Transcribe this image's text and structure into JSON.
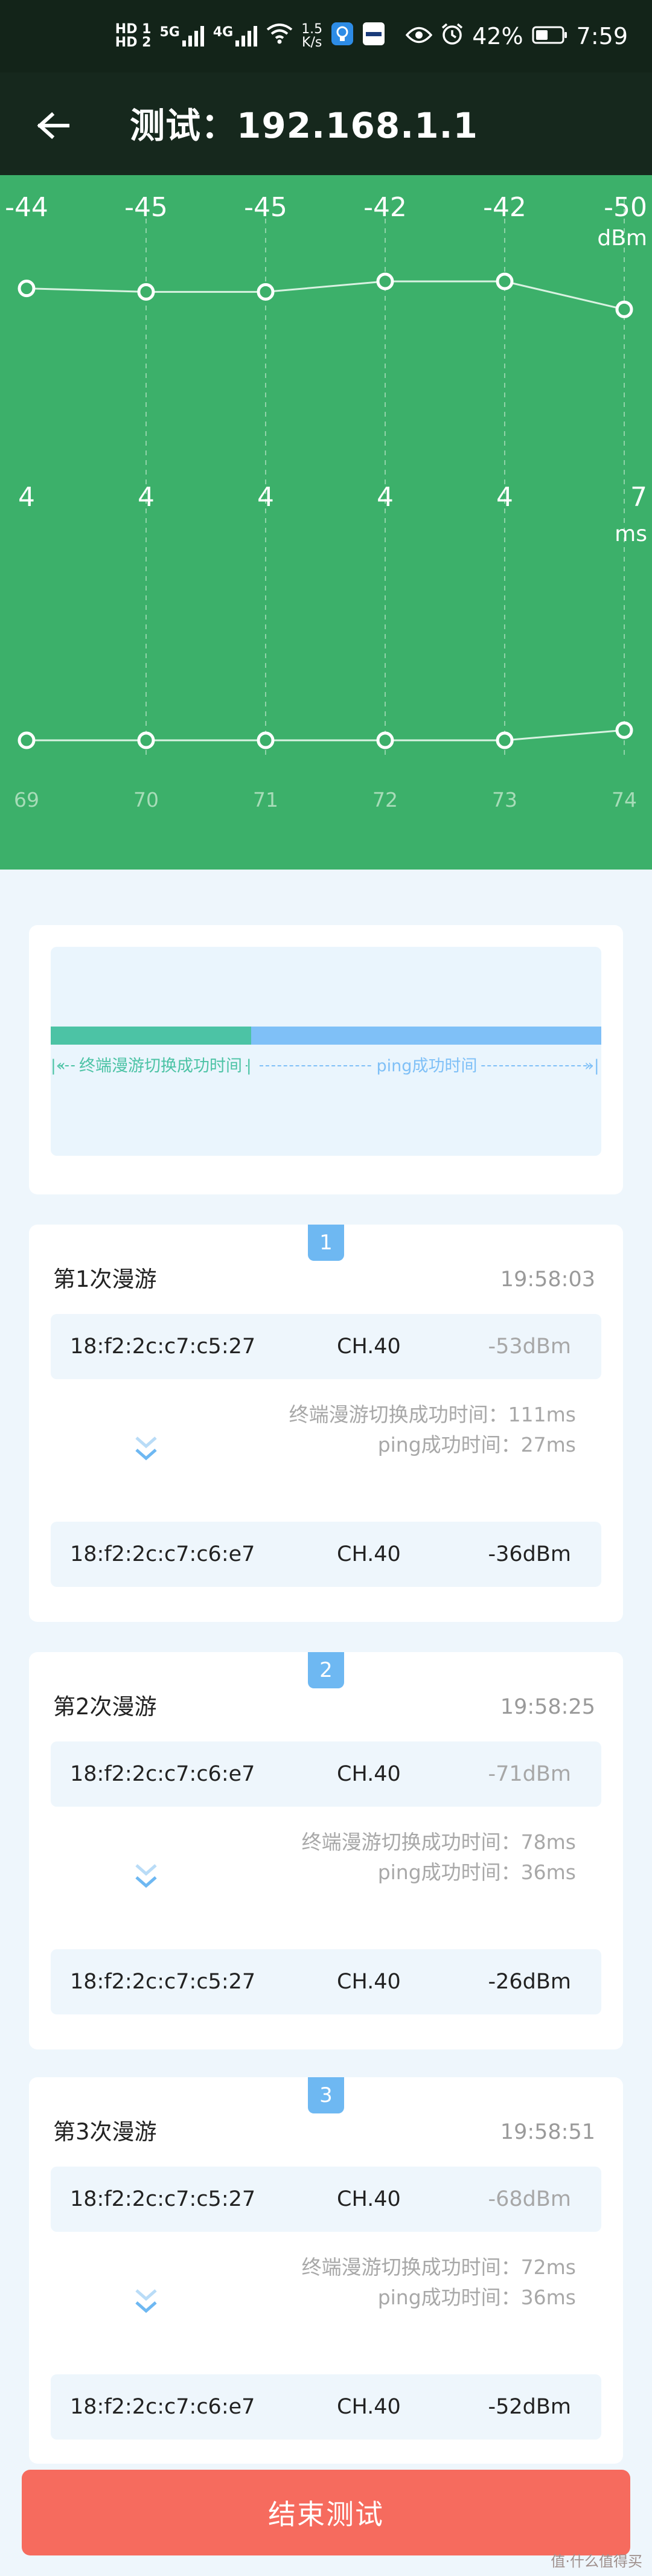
{
  "status_bar": {
    "net1": "HD 1",
    "net2": "HD 2",
    "sig1": "5G",
    "sig2": "4G",
    "speed_value": "1.5",
    "speed_unit": "K/s",
    "battery": "42%",
    "time": "7:59"
  },
  "app_bar": {
    "back_icon": "arrow-left-icon",
    "title": "测试：192.168.1.1"
  },
  "chart_data": [
    {
      "type": "line",
      "x": [
        69,
        70,
        71,
        72,
        73,
        74
      ],
      "values": [
        -44,
        -45,
        -45,
        -42,
        -42,
        -50
      ],
      "value_labels": [
        "-44",
        "-45",
        "-45",
        "-42",
        "-42",
        "-50"
      ],
      "unit": "dBm"
    },
    {
      "type": "line",
      "x": [
        69,
        70,
        71,
        72,
        73,
        74
      ],
      "x_labels": [
        "69",
        "70",
        "71",
        "72",
        "73",
        "74"
      ],
      "values": [
        4,
        4,
        4,
        4,
        4,
        7
      ],
      "value_labels": [
        "4",
        "4",
        "4",
        "4",
        "4",
        "7"
      ],
      "unit": "ms"
    }
  ],
  "legend": {
    "handover_label": "终端漫游切换成功时间",
    "ping_label": "ping成功时间",
    "handover_color": "#4cc3a5",
    "ping_color": "#7fc0f7"
  },
  "roams": [
    {
      "index": "1",
      "title": "第1次漫游",
      "time": "19:58:03",
      "from": {
        "mac": "18:f2:2c:c7:c5:27",
        "channel": "CH.40",
        "signal": "-53dBm"
      },
      "handover_text": "终端漫游切换成功时间：111ms",
      "ping_text": "ping成功时间：27ms",
      "to": {
        "mac": "18:f2:2c:c7:c6:e7",
        "channel": "CH.40",
        "signal": "-36dBm"
      }
    },
    {
      "index": "2",
      "title": "第2次漫游",
      "time": "19:58:25",
      "from": {
        "mac": "18:f2:2c:c7:c6:e7",
        "channel": "CH.40",
        "signal": "-71dBm"
      },
      "handover_text": "终端漫游切换成功时间：78ms",
      "ping_text": "ping成功时间：36ms",
      "to": {
        "mac": "18:f2:2c:c7:c5:27",
        "channel": "CH.40",
        "signal": "-26dBm"
      }
    },
    {
      "index": "3",
      "title": "第3次漫游",
      "time": "19:58:51",
      "from": {
        "mac": "18:f2:2c:c7:c5:27",
        "channel": "CH.40",
        "signal": "-68dBm"
      },
      "handover_text": "终端漫游切换成功时间：72ms",
      "ping_text": "ping成功时间：36ms",
      "to": {
        "mac": "18:f2:2c:c7:c6:e7",
        "channel": "CH.40",
        "signal": "-52dBm"
      }
    }
  ],
  "end_button": "结束测试",
  "watermark": "值·什么值得买"
}
